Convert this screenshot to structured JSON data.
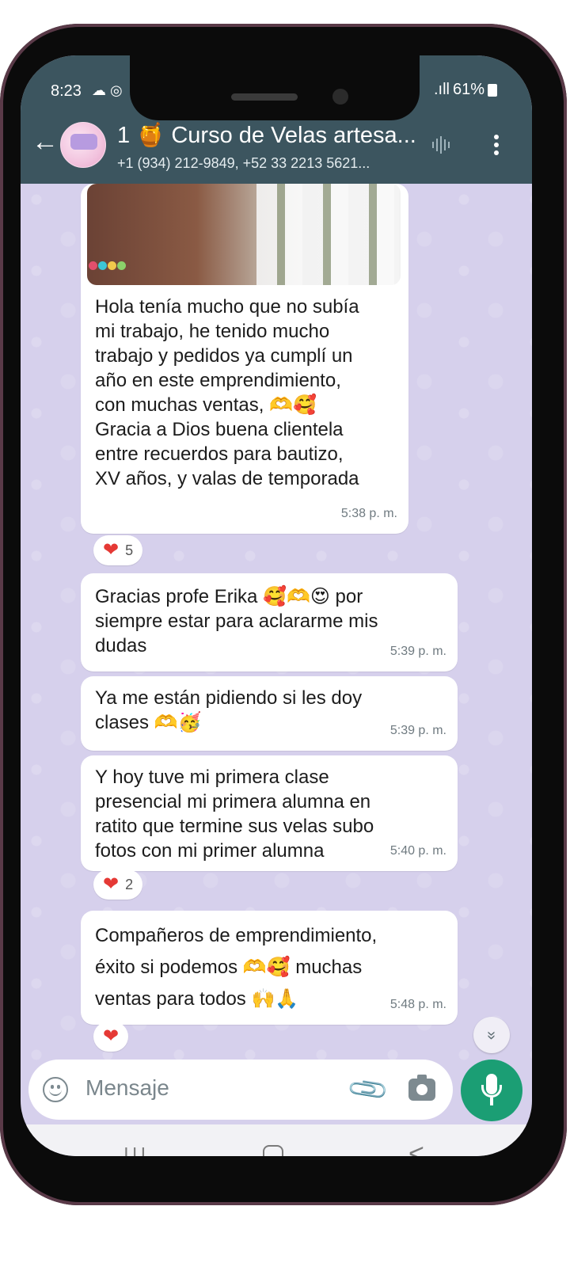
{
  "status_bar": {
    "time": "8:23",
    "left_icons": "☁ ◎",
    "signal": ".ıll",
    "battery_percent": "61%"
  },
  "header": {
    "title": "1 🍯 Curso de Velas artesa...",
    "subtitle": "+1 (934) 212-9849, +52 33 2213 5621..."
  },
  "messages": [
    {
      "id": "m1",
      "has_photo": true,
      "lines": [
        "Hola tenía mucho que no subía",
        "mi trabajo, he tenido mucho",
        "trabajo y pedidos ya cumplí un",
        "año en este emprendimiento,",
        "con muchas ventas, 🫶🥰",
        "Gracia a Dios buena clientela",
        "entre recuerdos para bautizo,",
        "XV años, y valas de temporada"
      ],
      "time": "5:38 p. m.",
      "reaction": {
        "emoji": "❤",
        "count": "5"
      }
    },
    {
      "id": "m2",
      "lines": [
        "Gracias profe Erika 🥰🫶😍 por",
        "siempre estar para aclararme mis",
        "dudas"
      ],
      "time": "5:39 p. m."
    },
    {
      "id": "m3",
      "lines": [
        "Ya me están pidiendo si les doy",
        "clases 🫶🥳"
      ],
      "time": "5:39 p. m."
    },
    {
      "id": "m4",
      "lines": [
        "Y hoy tuve mi primera clase",
        "presencial mi primera alumna en",
        "ratito que termine sus velas subo",
        "fotos con mi primer alumna"
      ],
      "time": "5:40 p. m.",
      "reaction": {
        "emoji": "❤",
        "count": "2"
      }
    },
    {
      "id": "m5",
      "lines": [
        "Compañeros de emprendimiento,",
        "éxito si podemos 🫶🥰 muchas",
        "ventas para todos 🙌🙏"
      ],
      "time": "5:48 p. m.",
      "reaction": {
        "emoji": "❤",
        "count": ""
      }
    }
  ],
  "composer": {
    "placeholder": "Mensaje"
  },
  "scroll_down_icon": "»",
  "colors": {
    "header_bg": "#3c555f",
    "chat_bg": "#d6d0ec",
    "bubble_bg": "#ffffff",
    "mic_button": "#1b9e74",
    "heart": "#e53935"
  },
  "icons": {
    "back": "back-arrow-icon",
    "menu": "more-vert-icon",
    "audio": "audio-wave-icon",
    "emoji": "emoji-icon",
    "attach": "paperclip-icon",
    "camera": "camera-icon",
    "mic": "mic-icon"
  }
}
